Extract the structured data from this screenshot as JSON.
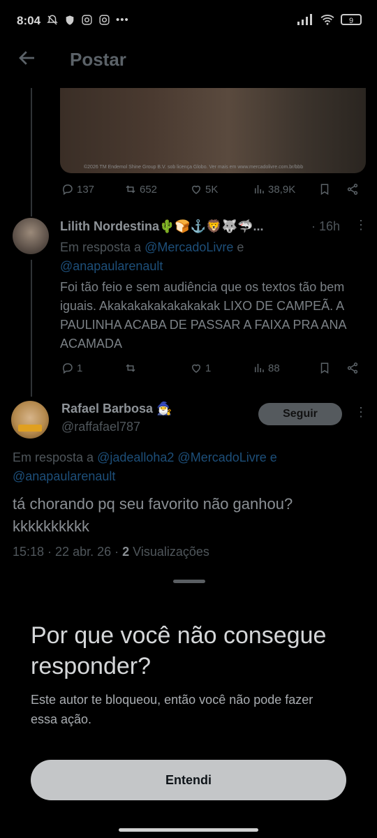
{
  "status_bar": {
    "time": "8:04",
    "left_icons": [
      "bell-off-icon",
      "shield-icon",
      "instagram-icon",
      "instagram-icon",
      "more-dots-icon"
    ],
    "battery": "9"
  },
  "header": {
    "title": "Postar"
  },
  "media": {
    "caption": "©2026 TM Endemol Shine Group B.V. sob licença Globo. Ver mais em www.mercadolivre.com.br/bbb"
  },
  "tweet1_actions": {
    "replies": "137",
    "retweets": "652",
    "likes": "5K",
    "views": "38,9K"
  },
  "tweet2": {
    "name": "Lilith Nordestina🌵🍞⚓🦁🐺🦈...",
    "time": "· 16h",
    "reply_label": "Em resposta a",
    "reply_mention1": "@MercadoLivre",
    "reply_and": "e",
    "reply_mention2": "@anapaularenault",
    "text": "Foi tão feio e sem audiência que os textos tão bem iguais. Akakakakakakakakak LIXO DE CAMPEÃ. A PAULINHA ACABA DE PASSAR A FAIXA PRA ANA ACAMADA",
    "replies": "1",
    "retweets": "",
    "likes": "1",
    "views": "88"
  },
  "tweet3": {
    "name": "Rafael Barbosa 🧙‍♂️",
    "handle": "@raffafael787",
    "follow_label": "Seguir",
    "reply_label": "Em resposta a",
    "reply_mentions": "@jadealloha2 @MercadoLivre",
    "reply_and": "e",
    "reply_mention3": "@anapaularenault",
    "text_line1": "tá chorando pq seu favorito não ganhou?",
    "text_line2": "kkkkkkkkkk",
    "meta_time": "15:18 · 22 abr. 26 ·",
    "meta_views_count": "2",
    "meta_views_label": "Visualizações"
  },
  "sheet": {
    "title": "Por que você não consegue responder?",
    "body": "Este autor te bloqueou, então você não pode fazer essa ação.",
    "button": "Entendi"
  }
}
